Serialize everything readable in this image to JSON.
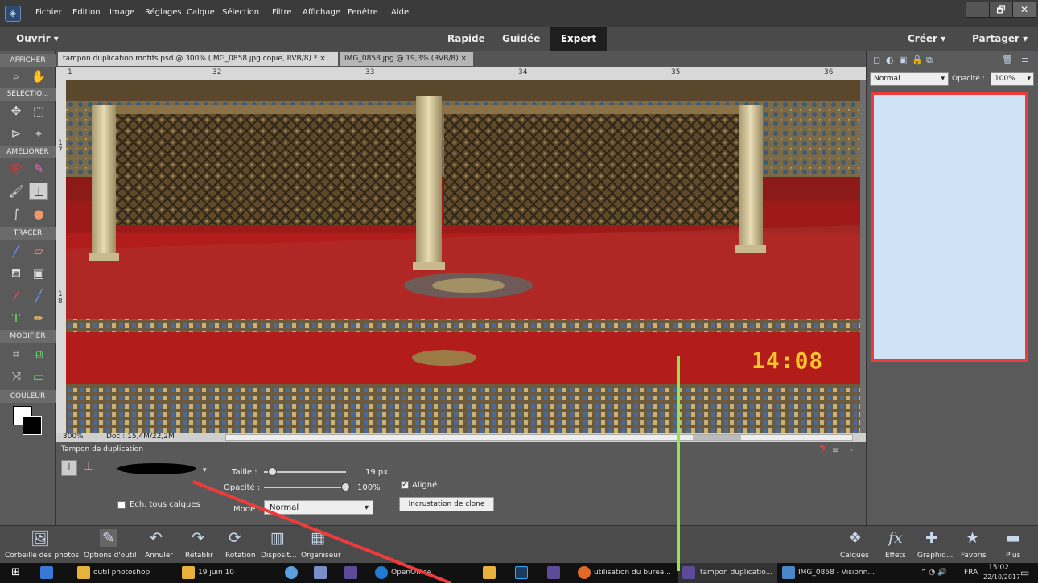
{
  "menubar": {
    "items": [
      "Fichier",
      "Edition",
      "Image",
      "Réglages",
      "Calque",
      "Sélection",
      "Filtre",
      "Affichage",
      "Fenêtre",
      "Aide"
    ],
    "win_minimize": "–",
    "win_restore": "🗗",
    "win_close": "✕"
  },
  "modebar": {
    "open": "Ouvrir",
    "rapide": "Rapide",
    "guidee": "Guidée",
    "expert": "Expert",
    "creer": "Créer",
    "partager": "Partager"
  },
  "toolbox": {
    "afficher": "AFFICHER",
    "selection": "SELECTIO...",
    "ameliorer": "AMELIORER",
    "tracer": "TRACER",
    "modifier": "MODIFIER",
    "couleur": "COULEUR"
  },
  "tabs": [
    {
      "label": "tampon duplication motifs.psd @ 300% (IMG_0858.jpg copie, RVB/8) *",
      "close": "×"
    },
    {
      "label": "IMG_0858.jpg @ 19,3% (RVB/8)",
      "close": "×"
    }
  ],
  "ruler": {
    "h": [
      "1",
      "32",
      "33",
      "34",
      "35",
      "36"
    ],
    "v": [
      "1\n7",
      "1\n8"
    ]
  },
  "canvas": {
    "timestamp": "14:08"
  },
  "status": {
    "zoom": "300%",
    "doc": "Doc : 15,4M/22,2M"
  },
  "options": {
    "tool_name": "Tampon de duplication",
    "taille_label": "Taille :",
    "taille_value": "19 px",
    "taille_fraction": 0.1,
    "opacite_label": "Opacité :",
    "opacite_value": "100%",
    "opacite_fraction": 1.0,
    "aligne_label": "Aligné",
    "ech_label": "Ech. tous calques",
    "mode_label": "Mode :",
    "mode_value": "Normal",
    "clone_button": "Incrustation de clone"
  },
  "layers_panel": {
    "blend_mode": "Normal",
    "opacity_label": "Opacité :",
    "opacity_value": "100%"
  },
  "bottombar": {
    "left": [
      "Corbeille des photos",
      "Options d'outil",
      "Annuler",
      "Rétablir",
      "Rotation",
      "Disposit...",
      "Organiseur"
    ],
    "right": [
      "Calques",
      "Effets",
      "Graphiq...",
      "Favoris",
      "Plus"
    ]
  },
  "taskbar": {
    "items": [
      "outil photoshop",
      "19 juin 10",
      "OpenOffice",
      "utilisation du burea...",
      "tampon duplicatio...",
      "IMG_0858 - Visionn..."
    ],
    "lang": "FRA",
    "time": "15:02",
    "date": "22/10/2017"
  },
  "colors": {
    "annotation_red": "#ee3c3c",
    "annotation_green": "#8ee84a",
    "layer_panel_fill": "#cfe3f6",
    "timestamp_yellow": "#ffc62a"
  }
}
